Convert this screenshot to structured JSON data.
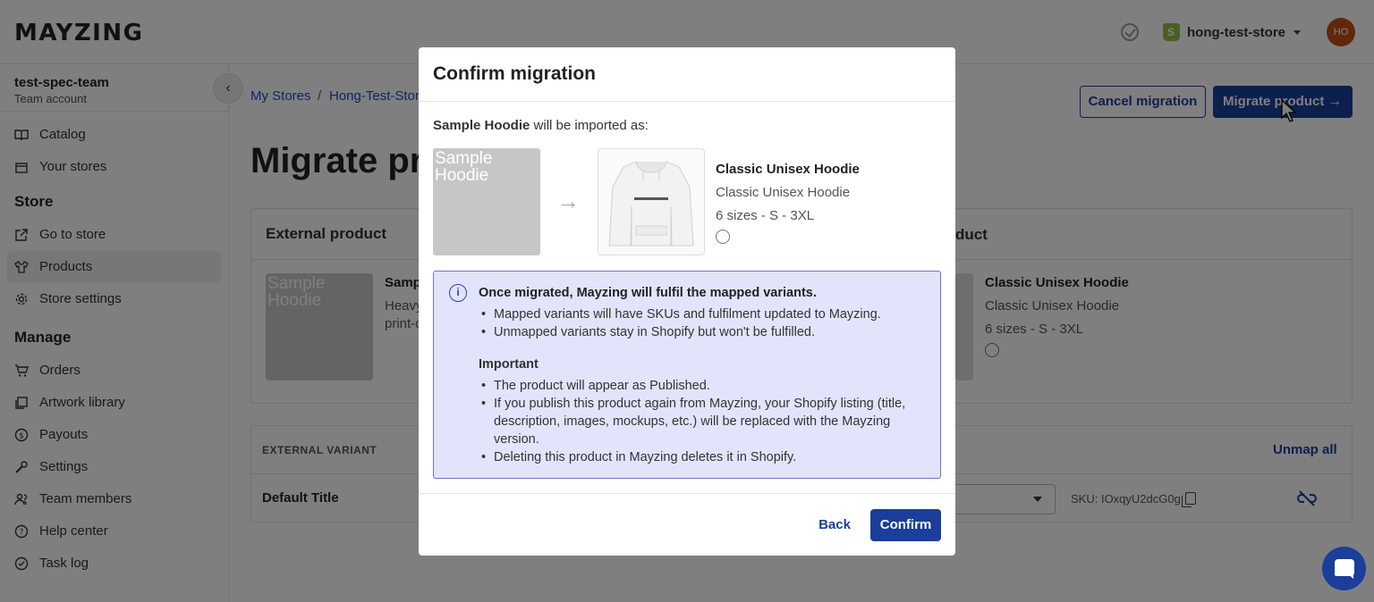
{
  "header": {
    "logo": "MAYZING",
    "store_name": "hong-test-store",
    "avatar_initials": "HO",
    "shopify_color": "#95bf47",
    "avatar_color": "#c24f16"
  },
  "sidebar": {
    "team_name": "test-spec-team",
    "team_type": "Team account",
    "items_top": [
      {
        "label": "Catalog",
        "icon": "book-icon"
      },
      {
        "label": "Your stores",
        "icon": "store-icon"
      }
    ],
    "store_section": "Store",
    "items_store": [
      {
        "label": "Go to store",
        "icon": "external-link-icon"
      },
      {
        "label": "Products",
        "icon": "shirt-icon",
        "active": true
      },
      {
        "label": "Store settings",
        "icon": "gear-icon"
      }
    ],
    "manage_section": "Manage",
    "items_manage": [
      {
        "label": "Orders",
        "icon": "cart-icon"
      },
      {
        "label": "Artwork library",
        "icon": "images-icon"
      },
      {
        "label": "Payouts",
        "icon": "dollar-icon"
      },
      {
        "label": "Settings",
        "icon": "wrench-icon"
      },
      {
        "label": "Team members",
        "icon": "users-icon"
      },
      {
        "label": "Help center",
        "icon": "help-icon"
      },
      {
        "label": "Task log",
        "icon": "check-circle-icon"
      }
    ]
  },
  "breadcrumb": {
    "items": [
      "My Stores",
      "Hong-Test-Stor"
    ],
    "separator": "/"
  },
  "actions": {
    "cancel_label": "Cancel migration",
    "migrate_label": "Migrate product",
    "migrate_arrow": "→"
  },
  "page": {
    "title": "Migrate pro"
  },
  "external_card": {
    "heading": "External product",
    "image_alt": "Sample Hoodie",
    "name": "Samp",
    "desc_line1": "Heavy",
    "desc_line2": "print-o"
  },
  "mayzing_card": {
    "heading": "duct",
    "name": "Classic Unisex Hoodie",
    "subtitle": "Classic Unisex Hoodie",
    "sizes": "6 sizes - S - 3XL"
  },
  "variants": {
    "column_header": "EXTERNAL VARIANT",
    "unmap_all_label": "Unmap all",
    "rows": [
      {
        "title": "Default Title",
        "sku": "SKU: IOxqyU2dcG0g"
      }
    ]
  },
  "modal": {
    "title": "Confirm migration",
    "import_product": "Sample Hoodie",
    "import_suffix": " will be imported as:",
    "from_image_alt": "Sample Hoodie",
    "arrow": "→",
    "to_name": "Classic Unisex Hoodie",
    "to_subtitle": "Classic Unisex Hoodie",
    "to_sizes": "6 sizes - S - 3XL",
    "info": {
      "icon": "i",
      "title": "Once migrated, Mayzing will fulfil the mapped variants.",
      "bullets": [
        "Mapped variants will have SKUs and fulfilment updated to Mayzing.",
        "Unmapped variants stay in Shopify but won't be fulfilled."
      ],
      "important_title": "Important",
      "important_bullets": [
        "The product will appear as Published.",
        "If you publish this product again from Mayzing, your Shopify listing (title, description, images, mockups, etc.) will be replaced with the Mayzing version.",
        "Deleting this product in Mayzing deletes it in Shopify."
      ]
    },
    "back_label": "Back",
    "confirm_label": "Confirm"
  },
  "colors": {
    "brand_blue": "#1a3e9a",
    "info_bg": "#e2e4fc",
    "info_border": "#6b74d6"
  }
}
